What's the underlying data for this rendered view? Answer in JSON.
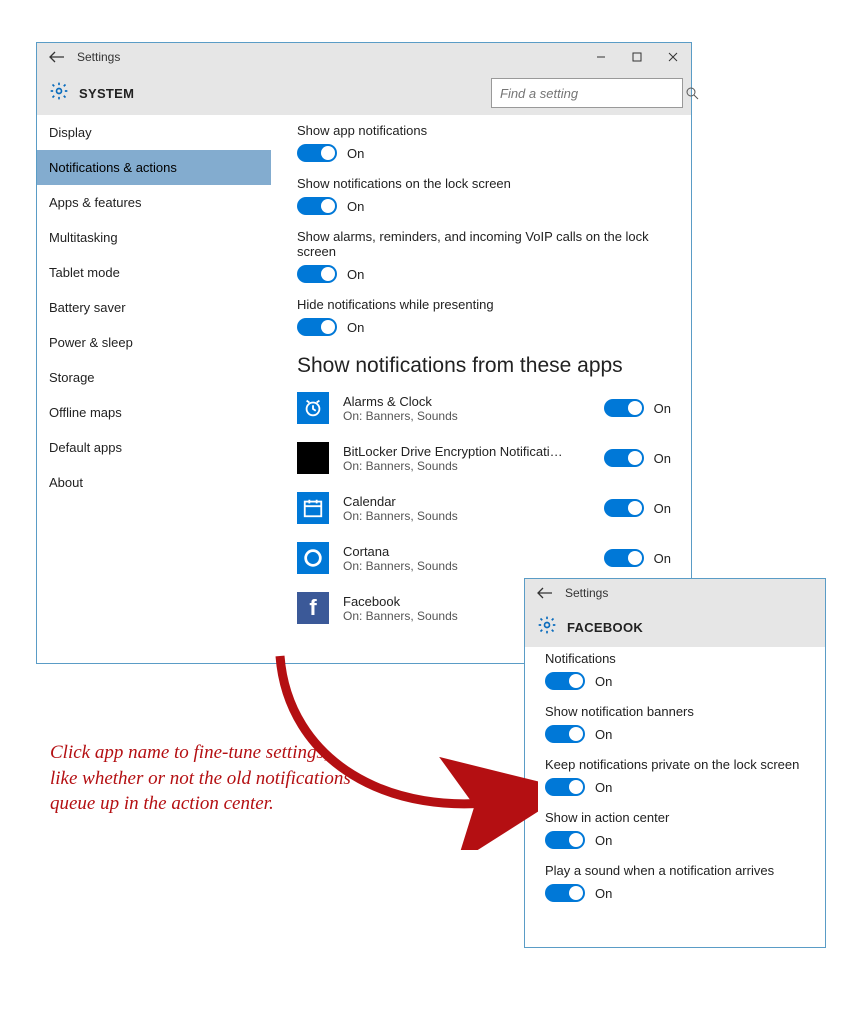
{
  "mainWindow": {
    "titlebar": {
      "title": "Settings"
    },
    "header": {
      "title": "SYSTEM"
    },
    "search": {
      "placeholder": "Find a setting"
    },
    "sidebar": {
      "items": [
        {
          "label": "Display"
        },
        {
          "label": "Notifications & actions"
        },
        {
          "label": "Apps & features"
        },
        {
          "label": "Multitasking"
        },
        {
          "label": "Tablet mode"
        },
        {
          "label": "Battery saver"
        },
        {
          "label": "Power & sleep"
        },
        {
          "label": "Storage"
        },
        {
          "label": "Offline maps"
        },
        {
          "label": "Default apps"
        },
        {
          "label": "About"
        }
      ],
      "activeIndex": 1
    },
    "content": {
      "settings": [
        {
          "label": "Show app notifications",
          "state": "On"
        },
        {
          "label": "Show notifications on the lock screen",
          "state": "On"
        },
        {
          "label": "Show alarms, reminders, and incoming VoIP calls on the lock screen",
          "state": "On"
        },
        {
          "label": "Hide notifications while presenting",
          "state": "On"
        }
      ],
      "sectionTitle": "Show notifications from these apps",
      "apps": [
        {
          "name": "Alarms & Clock",
          "sub": "On: Banners, Sounds",
          "state": "On",
          "iconKey": "alarms"
        },
        {
          "name": "BitLocker Drive Encryption Notification Utili…",
          "sub": "On: Banners, Sounds",
          "state": "On",
          "iconKey": "bitlocker"
        },
        {
          "name": "Calendar",
          "sub": "On: Banners, Sounds",
          "state": "On",
          "iconKey": "calendar"
        },
        {
          "name": "Cortana",
          "sub": "On: Banners, Sounds",
          "state": "On",
          "iconKey": "cortana"
        },
        {
          "name": "Facebook",
          "sub": "On: Banners, Sounds",
          "state": "",
          "iconKey": "facebook"
        }
      ]
    }
  },
  "detailWindow": {
    "titlebar": {
      "title": "Settings"
    },
    "header": {
      "title": "FACEBOOK"
    },
    "settings": [
      {
        "label": "Notifications",
        "state": "On"
      },
      {
        "label": "Show notification banners",
        "state": "On"
      },
      {
        "label": "Keep notifications private on the lock screen",
        "state": "On"
      },
      {
        "label": "Show in action center",
        "state": "On"
      },
      {
        "label": "Play a sound when a notification arrives",
        "state": "On"
      }
    ]
  },
  "annotation": {
    "text": "Click app name to fine-tune settings, like whether or not the old notifications queue up in the action center."
  }
}
